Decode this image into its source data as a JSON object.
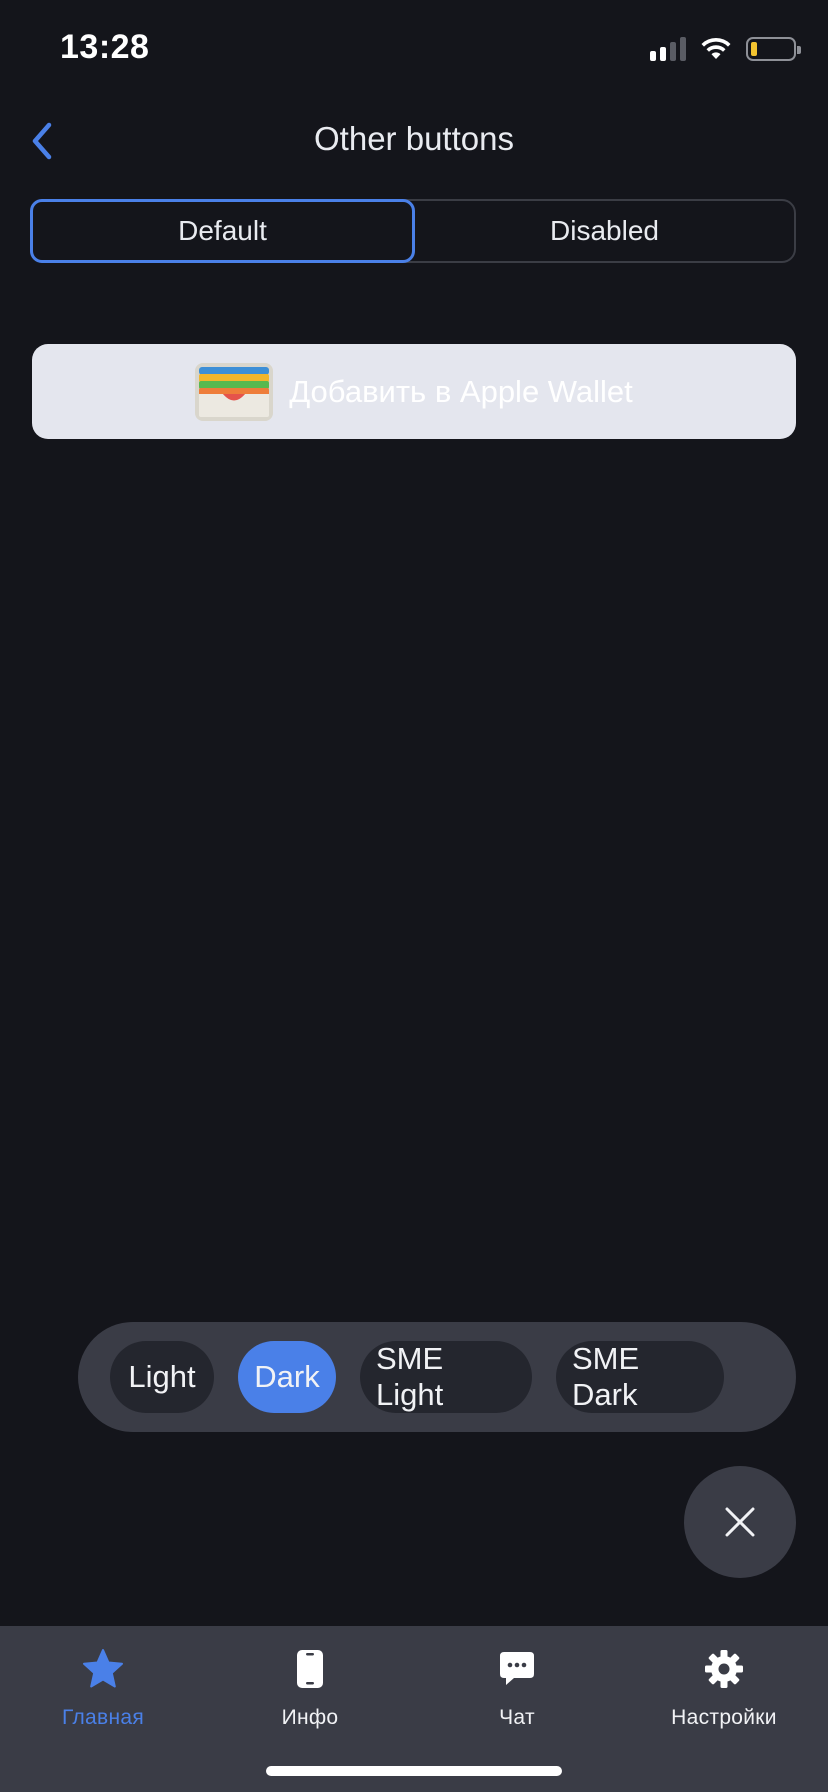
{
  "status_bar": {
    "time": "13:28",
    "battery_color": "#f4c430"
  },
  "header": {
    "title": "Other buttons",
    "back_icon": "chevron-left-icon"
  },
  "segmented": {
    "options": [
      {
        "label": "Default",
        "selected": true
      },
      {
        "label": "Disabled",
        "selected": false
      }
    ]
  },
  "wallet_button": {
    "label": "Добавить в Apple Wallet",
    "icon": "apple-wallet-icon"
  },
  "theme_switcher": {
    "options": [
      {
        "label": "Light",
        "selected": false
      },
      {
        "label": "Dark",
        "selected": true
      },
      {
        "label": "SME Light",
        "selected": false
      },
      {
        "label": "SME Dark",
        "selected": false
      }
    ]
  },
  "close_button": {
    "icon": "close-icon"
  },
  "tab_bar": {
    "items": [
      {
        "label": "Главная",
        "icon": "star-icon",
        "active": true
      },
      {
        "label": "Инфо",
        "icon": "phone-icon",
        "active": false
      },
      {
        "label": "Чат",
        "icon": "chat-bubble-icon",
        "active": false
      },
      {
        "label": "Настройки",
        "icon": "gear-icon",
        "active": false
      }
    ]
  },
  "colors": {
    "background": "#14151b",
    "accent": "#4a80e8",
    "surface": "#3a3c46",
    "chip": "#24262e",
    "wallet_button_bg": "#e4e6ee"
  }
}
